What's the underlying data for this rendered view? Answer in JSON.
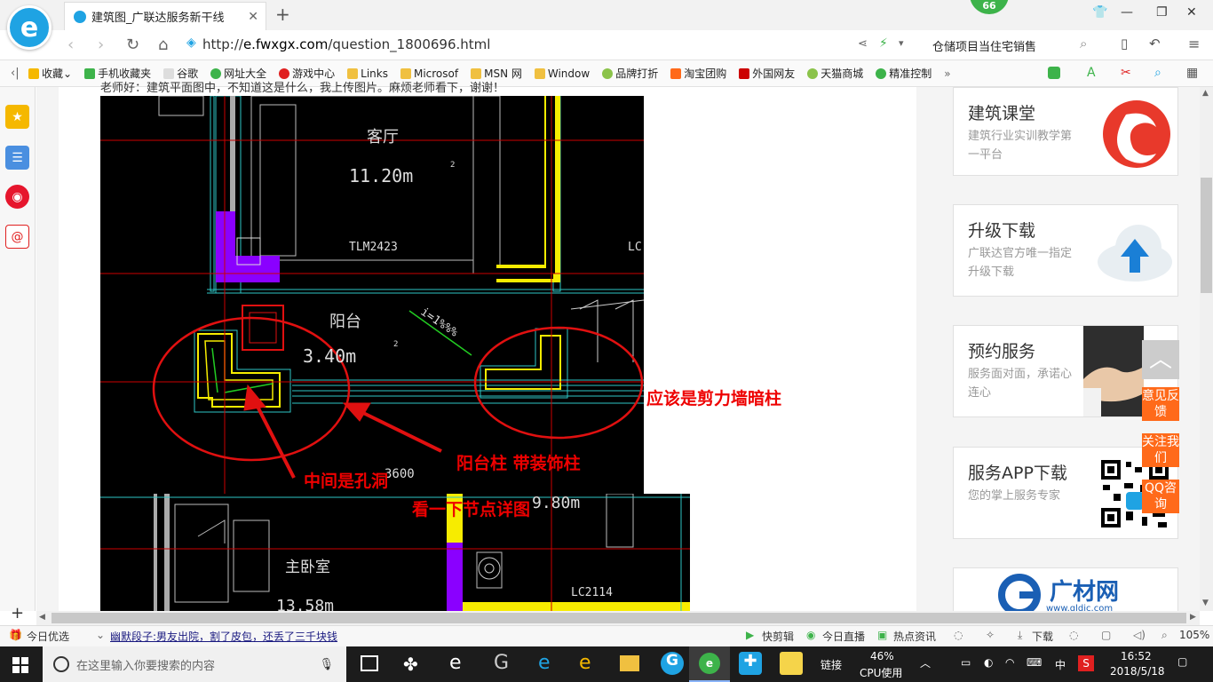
{
  "browser": {
    "tab_title": "建筑图_广联达服务新干线",
    "badge_count": "66",
    "url_prefix": "http://",
    "url_domain": "e.fwxgx.com",
    "url_path": "/question_1800696.html",
    "search_text": "仓储项目当住宅销售"
  },
  "bookmarks": [
    "收藏",
    "手机收藏夹",
    "谷歌",
    "网址大全",
    "游戏中心",
    "Links",
    "Microsof",
    "MSN 网",
    "Window",
    "品牌打折",
    "淘宝团购",
    "外国网友",
    "天猫商城",
    "精准控制"
  ],
  "question": {
    "text_cutoff": "老师好：建筑平面图中，不知道这是什么，我上传图片。麻烦老师看下，谢谢！"
  },
  "cad": {
    "room_living": "客厅",
    "area_living": "11.20m",
    "window_code_1": "TLM2423",
    "window_code_2": "LC",
    "room_balcony": "阳台",
    "area_balcony": "3.40m",
    "slope": "i=1%%%",
    "dim_3600": "3600",
    "area_980": "9.80m",
    "room_master": "主卧室",
    "area_master": "13.58m",
    "window_code_3": "LC2114",
    "num_2": "2"
  },
  "annotations": {
    "shear_wall": "应该是剪力墙暗柱",
    "balcony_column": "阳台柱 带装饰柱",
    "middle_hole": "中间是孔洞",
    "see_detail": "看一下节点详图"
  },
  "sidebar_cards": [
    {
      "title": "建筑课堂",
      "desc": "建筑行业实训教学第一平台"
    },
    {
      "title": "升级下载",
      "desc": "广联达官方唯一指定升级下载"
    },
    {
      "title": "预约服务",
      "desc": "服务面对面，承诺心连心"
    },
    {
      "title": "服务APP下载",
      "desc": "您的掌上服务专家"
    },
    {
      "title": "广材网",
      "desc": "www.gldjc.com"
    }
  ],
  "float_buttons": [
    "意见反馈",
    "关注我们",
    "QQ咨询"
  ],
  "status": {
    "today_pick": "今日优选",
    "news": "幽默段子:男友出院，割了皮包，还丢了三千块钱",
    "quick_cut": "快剪辑",
    "live": "今日直播",
    "hot_news": "热点资讯",
    "download": "下载",
    "zoom": "105%"
  },
  "taskbar": {
    "search_placeholder": "在这里输入你要搜索的内容",
    "link_label": "链接",
    "cpu_percent": "46%",
    "cpu_label": "CPU使用",
    "ime": "中",
    "time": "16:52",
    "date": "2018/5/18"
  },
  "colors": {
    "accent_blue": "#1fa3e3",
    "annotation_red": "#e00000",
    "float_orange": "#ff6a1a",
    "badge_green": "#3db34a"
  }
}
